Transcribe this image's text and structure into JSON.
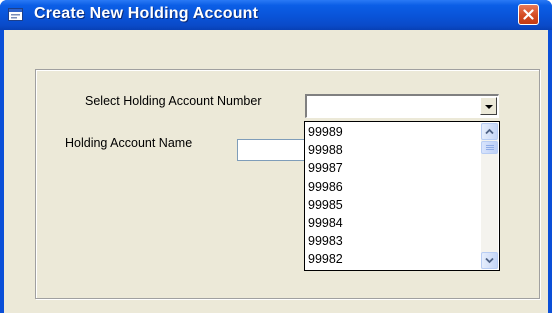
{
  "window": {
    "title": "Create New Holding Account",
    "title_icon": "window-app-icon",
    "close_icon": "close-icon",
    "colors": {
      "titlebar": "#0953d8",
      "client": "#ece9d8",
      "close": "#d44b22"
    }
  },
  "form": {
    "number_label": "Select Holding Account Number",
    "name_label": "Holding Account Name",
    "name_value": "",
    "combo": {
      "selected_value": "",
      "options": [
        "99989",
        "99988",
        "99987",
        "99986",
        "99985",
        "99984",
        "99983",
        "99982"
      ]
    }
  }
}
